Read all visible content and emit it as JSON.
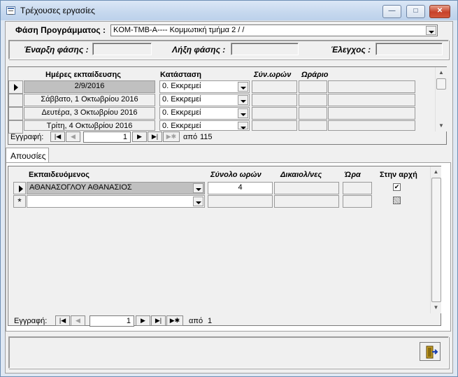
{
  "window": {
    "title": "Τρέχουσες εργασίες",
    "btn_min": "—",
    "btn_max": "□",
    "btn_close": "✕"
  },
  "phase": {
    "label": "Φάση Προγράμματος :",
    "value": "KOM-TMB-A---- Κομμωτική τμήμα 2 /  /",
    "start_label": "Έναρξη φάσης :",
    "start_value": "",
    "end_label": "Λήξη φάσης :",
    "end_value": "",
    "check_label": "Έλεγχος :",
    "check_value": ""
  },
  "sessions": {
    "headers": {
      "date": "Ημέρες εκπαίδευσης",
      "status": "Κατάσταση",
      "hours": "Σύν.ωρών",
      "schedule": "Ωράριο"
    },
    "rows": [
      {
        "date": "2/9/2016",
        "status": "0. Εκκρεμεί"
      },
      {
        "date": "Σάββατο, 1 Οκτωβρίου 2016",
        "status": "0. Εκκρεμεί"
      },
      {
        "date": "Δευτέρα, 3 Οκτωβρίου 2016",
        "status": "0. Εκκρεμεί"
      },
      {
        "date": "Τρίτη, 4 Οκτωβρίου 2016",
        "status": "0. Εκκρεμεί"
      }
    ],
    "nav": {
      "label": "Εγγραφή:",
      "current": "1",
      "of_label": "από",
      "total": "115"
    }
  },
  "tab": {
    "label": "Απουσίες"
  },
  "absences": {
    "headers": {
      "trainee": "Εκπαιδευόμενος",
      "total_hours": "Σύνολο ωρών",
      "justified": "Δικαιολ/νες",
      "hour": "Ώρα",
      "start": "Στην αρχή"
    },
    "rows": [
      {
        "trainee": "ΑΘΑΝΑΣΟΓΛΟΥ ΑΘΑΝΑΣΙΟΣ",
        "total_hours": "4",
        "start_checked": true
      }
    ],
    "newrow_marker": "*",
    "nav": {
      "label": "Εγγραφή:",
      "current": "1",
      "of_label": "από",
      "total": "1"
    }
  },
  "icons": {
    "check": "✔",
    "first": "|◀",
    "prev": "◀",
    "next": "▶",
    "last": "▶|",
    "new": "▶✱",
    "up": "▲",
    "down": "▼"
  }
}
